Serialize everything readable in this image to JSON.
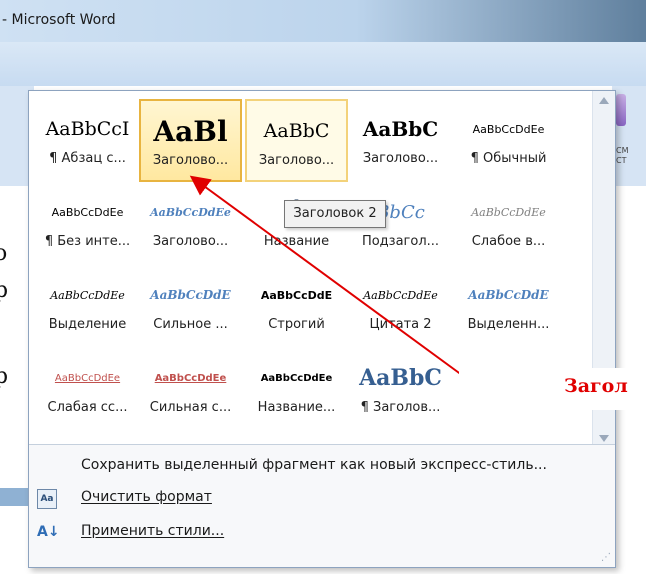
{
  "window": {
    "title": "- Microsoft Word"
  },
  "background": {
    "doc_chars": [
      "o",
      "p",
      "p"
    ]
  },
  "gallery": {
    "rows": [
      [
        {
          "sample": "AaBbCcI",
          "label": "¶ Абзац с...",
          "font": "serif",
          "size": 19,
          "bold": false,
          "italic": false,
          "color": "#000000",
          "state": "normal"
        },
        {
          "sample": "AaBl",
          "label": "Заголово...",
          "font": "serif",
          "size": 28,
          "bold": true,
          "italic": false,
          "color": "#000000",
          "state": "selected"
        },
        {
          "sample": "AaBbC",
          "label": "Заголово...",
          "font": "serif",
          "size": 19,
          "bold": false,
          "italic": false,
          "color": "#000000",
          "state": "hover"
        },
        {
          "sample": "AaBbC",
          "label": "Заголово...",
          "font": "serif",
          "size": 20,
          "bold": true,
          "italic": false,
          "color": "#000000",
          "state": "normal"
        },
        {
          "sample": "AaBbCcDdEe",
          "label": "¶ Обычный",
          "font": "sans",
          "size": 11,
          "bold": false,
          "italic": false,
          "color": "#000000",
          "state": "normal"
        }
      ],
      [
        {
          "sample": "AaBbCcDdEe",
          "label": "¶ Без инте...",
          "font": "sans",
          "size": 11,
          "bold": false,
          "italic": false,
          "color": "#000000",
          "state": "normal"
        },
        {
          "sample": "AaBbCcDdEe",
          "label": "Заголово...",
          "font": "serif",
          "size": 11,
          "bold": true,
          "italic": true,
          "color": "#4f81bd",
          "state": "normal"
        },
        {
          "sample": "A",
          "label": "Название",
          "font": "sans",
          "size": 32,
          "bold": false,
          "italic": false,
          "color": "#17365d",
          "state": "normal"
        },
        {
          "sample": "BbCc",
          "label": "Подзагол...",
          "font": "serif",
          "size": 18,
          "bold": false,
          "italic": true,
          "color": "#4f81bd",
          "state": "normal"
        },
        {
          "sample": "AaBbCcDdEe",
          "label": "Слабое в...",
          "font": "serif",
          "size": 11,
          "bold": false,
          "italic": true,
          "color": "#808080",
          "state": "normal"
        }
      ],
      [
        {
          "sample": "AaBbCcDdEe",
          "label": "Выделение",
          "font": "serif",
          "size": 11,
          "bold": false,
          "italic": true,
          "color": "#000000",
          "state": "normal"
        },
        {
          "sample": "AaBbCcDdE",
          "label": "Сильное ...",
          "font": "serif",
          "size": 12,
          "bold": true,
          "italic": true,
          "color": "#4f81bd",
          "state": "normal"
        },
        {
          "sample": "AaBbCcDdE",
          "label": "Строгий",
          "font": "sans",
          "size": 11,
          "bold": true,
          "italic": false,
          "color": "#000000",
          "state": "normal"
        },
        {
          "sample": "AaBbCcDdEe",
          "label": "Цитата 2",
          "font": "serif",
          "size": 11,
          "bold": false,
          "italic": true,
          "color": "#000000",
          "state": "normal"
        },
        {
          "sample": "AaBbCcDdE",
          "label": "Выделенн...",
          "font": "serif",
          "size": 12,
          "bold": true,
          "italic": true,
          "color": "#4f81bd",
          "state": "normal"
        }
      ],
      [
        {
          "sample": "AaBbCcDdEe",
          "label": "Слабая сс...",
          "font": "sans",
          "size": 10,
          "bold": false,
          "italic": false,
          "color": "#c0504d",
          "state": "normal"
        },
        {
          "sample": "AaBbCcDdEe",
          "label": "Сильная с...",
          "font": "sans",
          "size": 10,
          "bold": true,
          "italic": false,
          "color": "#c0504d",
          "state": "normal"
        },
        {
          "sample": "AaBbCcDdEe",
          "label": "Название...",
          "font": "sans",
          "size": 10,
          "bold": true,
          "italic": false,
          "color": "#000000",
          "state": "normal"
        },
        {
          "sample": "AaBbC",
          "label": "¶ Заголов...",
          "font": "serif",
          "size": 22,
          "bold": true,
          "italic": false,
          "color": "#365f91",
          "state": "normal"
        }
      ]
    ]
  },
  "tooltip": {
    "text": "Заголовок 2"
  },
  "menu": {
    "items": [
      {
        "label": "Сохранить выделенный фрагмент как новый экспресс-стиль...",
        "icon": "",
        "underline": false
      },
      {
        "label": "Очистить формат",
        "icon": "clear-format-icon",
        "underline": true
      },
      {
        "label": "Применить стили...",
        "icon": "apply-styles-icon",
        "underline": true
      }
    ]
  },
  "callout": {
    "text": "Загол"
  },
  "colors": {
    "arrow": "#e00000",
    "selected_border": "#e8b440",
    "accent": "#4f81bd"
  }
}
